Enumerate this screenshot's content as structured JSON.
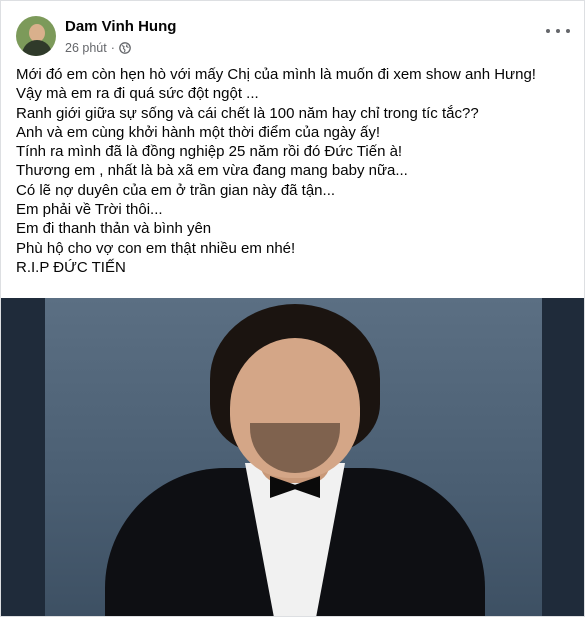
{
  "post": {
    "author": "Dam Vinh Hung",
    "time": "26 phút",
    "separator": "·",
    "lines": [
      "Mới đó em còn hẹn hò với mấy Chị của mình là muốn đi xem show anh Hưng!",
      "Vậy mà em ra đi quá sức đột ngột ...",
      "Ranh giới giữa sự sống và cái chết là 100 năm hay chỉ trong tíc tắc??",
      "Anh và em cùng khởi hành một thời điểm của ngày ấy!",
      "Tính ra mình đã là đồng nghiệp 25 năm rồi đó Đức Tiến à!",
      "Thương em , nhất là bà xã em vừa đang mang baby nữa...",
      "Có lẽ nợ duyên của em ở trần gian này đã tận...",
      "Em phải về Trời thôi...",
      "Em đi thanh thản và bình yên",
      "Phù hộ cho vợ con em thật nhiều em nhé!",
      "R.I.P ĐỨC TIẾN"
    ]
  },
  "icons": {
    "privacy": "globe-icon",
    "menu": "more-options-icon"
  }
}
